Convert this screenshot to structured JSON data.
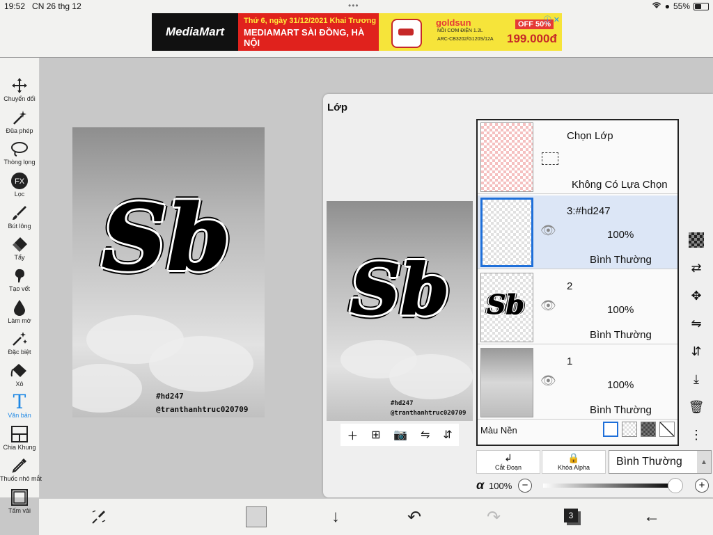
{
  "status_bar": {
    "time": "19:52",
    "date": "CN 26 thg 12",
    "battery": "55%",
    "battery_level": 0.55
  },
  "ad": {
    "brand": "MediaMart",
    "date_line": "Thứ 6, ngày 31/12/2021 Khai Trương",
    "headline": "MEDIAMART SÀI ĐỒNG, HÀ NỘI",
    "product_brand": "goldsun",
    "product_name": "NỒI CƠM ĐIỆN 1.2L",
    "product_model": "ARC-CB3202/G120S/12A",
    "discount": "OFF 50%",
    "price": "199.000đ"
  },
  "toolbar": {
    "items": [
      {
        "label": "Chuyển đổi",
        "icon": "move-icon"
      },
      {
        "label": "Đũa phép",
        "icon": "magic-wand-icon"
      },
      {
        "label": "Thòng lọng",
        "icon": "lasso-icon"
      },
      {
        "label": "Lọc",
        "icon": "fx-filter-icon"
      },
      {
        "label": "Bút lông",
        "icon": "brush-icon"
      },
      {
        "label": "Tẩy",
        "icon": "eraser-icon"
      },
      {
        "label": "Tạo vết",
        "icon": "smudge-icon"
      },
      {
        "label": "Làm mờ",
        "icon": "blur-icon"
      },
      {
        "label": "Đặc biệt",
        "icon": "special-icon"
      },
      {
        "label": "Xô",
        "icon": "bucket-icon"
      },
      {
        "label": "Văn bản",
        "icon": "text-icon"
      },
      {
        "label": "Chia Khung",
        "icon": "frame-divider-icon"
      },
      {
        "label": "Thuốc nhỏ mắt",
        "icon": "eyedropper-icon"
      },
      {
        "label": "Tấm vải",
        "icon": "canvas-icon"
      }
    ],
    "selected": "Văn bản"
  },
  "artwork": {
    "logo_text": "Sb",
    "tag_line1": "#hd247",
    "tag_line2": "@tranthanhtruc020709"
  },
  "layers_panel": {
    "title": "Lớp",
    "selection_row": {
      "title": "Chọn Lớp",
      "status": "Không Có Lựa Chọn"
    },
    "layers": [
      {
        "name": "3:#hd247",
        "opacity": "100%",
        "blend": "Bình Thường",
        "selected": true
      },
      {
        "name": "2",
        "opacity": "100%",
        "blend": "Bình Thường",
        "selected": false
      },
      {
        "name": "1",
        "opacity": "100%",
        "blend": "Bình Thường",
        "selected": false
      }
    ],
    "background_label": "Màu Nền",
    "clip_label": "Cắt Đoạn",
    "alpha_lock_label": "Khóa Alpha",
    "blend_mode": "Bình Thường",
    "alpha_symbol": "α",
    "alpha_value": "100%",
    "alpha_level": 1.0,
    "minus": "−",
    "plus": "+"
  },
  "bottom_bar": {
    "layer_count": "3"
  }
}
